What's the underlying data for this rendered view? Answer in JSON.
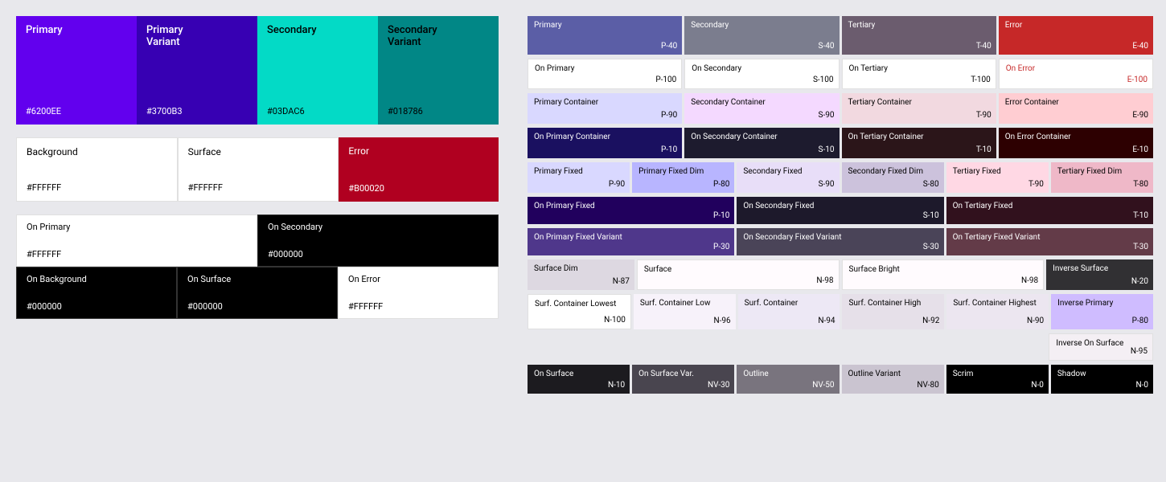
{
  "left": {
    "primary_row": [
      {
        "name": "Primary",
        "hex": "#6200EE",
        "bg": "#6200EE",
        "text_color": "#FFFFFF"
      },
      {
        "name": "Primary\nVariant",
        "hex": "#3700B3",
        "bg": "#3700B3",
        "text_color": "#FFFFFF"
      },
      {
        "name": "Secondary",
        "hex": "#03DAC6",
        "bg": "#03DAC6",
        "text_color": "#000000"
      },
      {
        "name": "Secondary\nVariant",
        "hex": "#018786",
        "bg": "#018786",
        "text_color": "#000000"
      }
    ],
    "neutral_row": [
      {
        "name": "Background",
        "hex": "#FFFFFF",
        "bg": "#FFFFFF",
        "text_color": "#000000"
      },
      {
        "name": "Surface",
        "hex": "#FFFFFF",
        "bg": "#FFFFFF",
        "text_color": "#000000"
      },
      {
        "name": "Error",
        "hex": "#B00020",
        "bg": "#B00020",
        "text_color": "#FFFFFF"
      }
    ],
    "on_top": [
      {
        "name": "On Primary",
        "hex": "#FFFFFF",
        "bg": "#FFFFFF",
        "text_color": "#000000"
      },
      {
        "name": "On Secondary",
        "hex": "#000000",
        "bg": "#000000",
        "text_color": "#FFFFFF"
      }
    ],
    "on_bottom": [
      {
        "name": "On Background",
        "hex": "#000000",
        "bg": "#000000",
        "text_color": "#FFFFFF"
      },
      {
        "name": "On Surface",
        "hex": "#000000",
        "bg": "#000000",
        "text_color": "#FFFFFF"
      },
      {
        "name": "On Error",
        "hex": "#FFFFFF",
        "bg": "#FFFFFF",
        "text_color": "#000000"
      }
    ]
  },
  "right": {
    "row1": [
      {
        "name": "Primary",
        "code": "P-40",
        "bg": "#5B5EA6",
        "text": "#FFFFFF",
        "flex": 1
      },
      {
        "name": "Secondary",
        "code": "S-40",
        "bg": "#7B7D8E",
        "text": "#FFFFFF",
        "flex": 1
      },
      {
        "name": "Tertiary",
        "code": "T-40",
        "bg": "#6B5C6E",
        "text": "#FFFFFF",
        "flex": 1
      },
      {
        "name": "Error",
        "code": "E-40",
        "bg": "#C62828",
        "text": "#FFFFFF",
        "flex": 1
      }
    ],
    "row2": [
      {
        "name": "On Primary",
        "code": "P-100",
        "bg": "#FFFFFF",
        "text": "#000000",
        "flex": 1
      },
      {
        "name": "On Secondary",
        "code": "S-100",
        "bg": "#FFFFFF",
        "text": "#000000",
        "flex": 1
      },
      {
        "name": "On Tertiary",
        "code": "T-100",
        "bg": "#FFFFFF",
        "text": "#000000",
        "flex": 1
      },
      {
        "name": "On Error",
        "code": "E-100",
        "bg": "#FFFFFF",
        "text": "#C62828",
        "flex": 1
      }
    ],
    "row3": [
      {
        "name": "Primary Container",
        "code": "P-90",
        "bg": "#D9D8FF",
        "text": "#000000",
        "flex": 1
      },
      {
        "name": "Secondary Container",
        "code": "S-90",
        "bg": "#F4D9FF",
        "text": "#000000",
        "flex": 1
      },
      {
        "name": "Tertiary Container",
        "code": "T-90",
        "bg": "#F2D9E0",
        "text": "#000000",
        "flex": 1
      },
      {
        "name": "Error Container",
        "code": "E-90",
        "bg": "#FFCDD2",
        "text": "#000000",
        "flex": 1
      }
    ],
    "row4": [
      {
        "name": "On Primary Container",
        "code": "P-10",
        "bg": "#1A1060",
        "text": "#FFFFFF",
        "flex": 1
      },
      {
        "name": "On Secondary Container",
        "code": "S-10",
        "bg": "#1D1B2E",
        "text": "#FFFFFF",
        "flex": 1
      },
      {
        "name": "On Tertiary Container",
        "code": "T-10",
        "bg": "#2B1519",
        "text": "#FFFFFF",
        "flex": 1
      },
      {
        "name": "On Error Container",
        "code": "E-10",
        "bg": "#2D0001",
        "text": "#FFFFFF",
        "flex": 1
      }
    ],
    "row5": [
      {
        "name": "Primary Fixed",
        "code": "P-90",
        "bg": "#D9D8FF",
        "text": "#000000",
        "flex": 1
      },
      {
        "name": "Primary Fixed Dim",
        "code": "P-80",
        "bg": "#B8B5FF",
        "text": "#000000",
        "flex": 1
      },
      {
        "name": "Secondary Fixed",
        "code": "S-90",
        "bg": "#E8DEF8",
        "text": "#000000",
        "flex": 1
      },
      {
        "name": "Secondary Fixed Dim",
        "code": "S-80",
        "bg": "#CCC2DC",
        "text": "#000000",
        "flex": 1
      },
      {
        "name": "Tertiary Fixed",
        "code": "T-90",
        "bg": "#FFD8E4",
        "text": "#000000",
        "flex": 1
      },
      {
        "name": "Tertiary Fixed Dim",
        "code": "T-80",
        "bg": "#EFB8C8",
        "text": "#000000",
        "flex": 1
      }
    ],
    "row6": [
      {
        "name": "On Primary Fixed",
        "code": "P-10",
        "bg": "#21005D",
        "text": "#FFFFFF",
        "flex": 2
      },
      {
        "name": "On Secondary Fixed",
        "code": "S-10",
        "bg": "#1D192B",
        "text": "#FFFFFF",
        "flex": 2
      },
      {
        "name": "On Tertiary Fixed",
        "code": "T-10",
        "bg": "#31111D",
        "text": "#FFFFFF",
        "flex": 2
      }
    ],
    "row7": [
      {
        "name": "On Primary Fixed Variant",
        "code": "P-30",
        "bg": "#4F378B",
        "text": "#FFFFFF",
        "flex": 2
      },
      {
        "name": "On Secondary Fixed Variant",
        "code": "S-30",
        "bg": "#4A4458",
        "text": "#FFFFFF",
        "flex": 2
      },
      {
        "name": "On Tertiary Fixed Variant",
        "code": "T-30",
        "bg": "#633B48",
        "text": "#FFFFFF",
        "flex": 2
      }
    ],
    "row8": [
      {
        "name": "Surface Dim",
        "code": "N-87",
        "bg": "#DDD8E1",
        "text": "#000000",
        "flex": 1
      },
      {
        "name": "Surface",
        "code": "N-98",
        "bg": "#FFFBFE",
        "text": "#000000",
        "flex": 2
      },
      {
        "name": "Surface Bright",
        "code": "N-98",
        "bg": "#FFFBFE",
        "text": "#000000",
        "flex": 2
      },
      {
        "name": "Inverse Surface",
        "code": "N-20",
        "bg": "#313033",
        "text": "#FFFFFF",
        "flex": 1
      }
    ],
    "row9": [
      {
        "name": "",
        "code": "",
        "bg": "#DDD8E1",
        "text": "#000000",
        "flex": 1
      },
      {
        "name": "",
        "code": "",
        "bg": "#FFFBFE",
        "text": "#000000",
        "flex": 2
      },
      {
        "name": "",
        "code": "",
        "bg": "#FFFBFE",
        "text": "#000000",
        "flex": 2
      },
      {
        "name": "Inverse On Surface",
        "code": "N-95",
        "bg": "#F4EFF4",
        "text": "#000000",
        "flex": 1
      }
    ],
    "row10": [
      {
        "name": "Surf. Container Lowest",
        "code": "N-100",
        "bg": "#FFFFFF",
        "text": "#000000",
        "flex": 1
      },
      {
        "name": "Surf. Container Low",
        "code": "N-96",
        "bg": "#F7F2FA",
        "text": "#000000",
        "flex": 1
      },
      {
        "name": "Surf. Container",
        "code": "N-94",
        "bg": "#EDE8F5",
        "text": "#000000",
        "flex": 1
      },
      {
        "name": "Surf. Container High",
        "code": "N-92",
        "bg": "#E6E0E9",
        "text": "#000000",
        "flex": 1
      },
      {
        "name": "Surf. Container Highest",
        "code": "N-90",
        "bg": "#ECE6F0",
        "text": "#000000",
        "flex": 1
      },
      {
        "name": "Inverse Primary",
        "code": "P-80",
        "bg": "#CFBCFF",
        "text": "#000000",
        "flex": 1
      }
    ],
    "row11": [
      {
        "name": "On Surface",
        "code": "N-10",
        "bg": "#1C1B1F",
        "text": "#FFFFFF",
        "flex": 1
      },
      {
        "name": "On Surface Var.",
        "code": "NV-30",
        "bg": "#49454F",
        "text": "#FFFFFF",
        "flex": 1
      },
      {
        "name": "Outline",
        "code": "NV-50",
        "bg": "#79747E",
        "text": "#FFFFFF",
        "flex": 1
      },
      {
        "name": "Outline Variant",
        "code": "NV-80",
        "bg": "#CAC4D0",
        "text": "#000000",
        "flex": 1
      },
      {
        "name": "Scrim",
        "code": "N-0",
        "bg": "#000000",
        "text": "#FFFFFF",
        "flex": 1
      },
      {
        "name": "Shadow",
        "code": "N-0",
        "bg": "#000000",
        "text": "#FFFFFF",
        "flex": 1
      }
    ]
  }
}
